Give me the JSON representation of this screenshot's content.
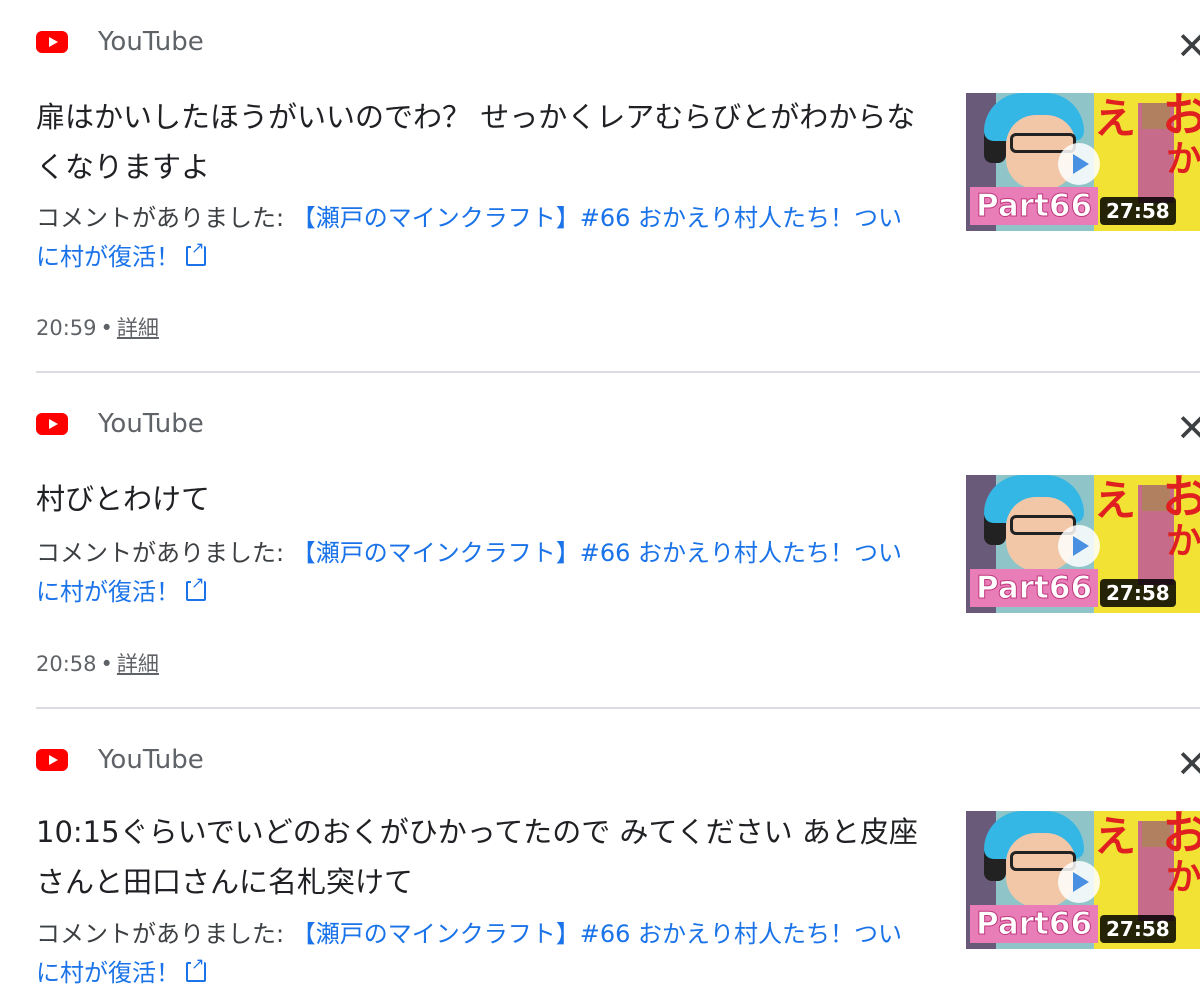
{
  "colors": {
    "youtube_red": "#ff0000",
    "link_blue": "#1a73e8",
    "divider": "#dadce0"
  },
  "notifications": [
    {
      "app_name": "YouTube",
      "app_icon": "youtube-logo-icon",
      "close_icon": "close-icon",
      "message": "扉はかいしたほうがいいのでわ？ せっかくレアむらびとがわからなくなりますよ",
      "comment_prefix": "コメントがありました: ",
      "video_title": "【瀬戸のマインクラフト】#66 おかえり村人たち！ついに村が復活！",
      "time": "20:59",
      "separator": "•",
      "details_label": "詳細",
      "thumbnail": {
        "label": "Part66",
        "duration": "27:58",
        "text_1": "え",
        "text_2": "お",
        "text_3": "か"
      }
    },
    {
      "app_name": "YouTube",
      "app_icon": "youtube-logo-icon",
      "close_icon": "close-icon",
      "message": "村びとわけて",
      "comment_prefix": "コメントがありました: ",
      "video_title": "【瀬戸のマインクラフト】#66 おかえり村人たち！ついに村が復活！",
      "time": "20:58",
      "separator": "•",
      "details_label": "詳細",
      "thumbnail": {
        "label": "Part66",
        "duration": "27:58",
        "text_1": "え",
        "text_2": "お",
        "text_3": "か"
      }
    },
    {
      "app_name": "YouTube",
      "app_icon": "youtube-logo-icon",
      "close_icon": "close-icon",
      "message": "10:15ぐらいでいどのおくがひかってたので みてください あと皮座さんと田口さんに名札突けて",
      "comment_prefix": "コメントがありました: ",
      "video_title": "【瀬戸のマインクラフト】#66 おかえり村人たち！ついに村が復活！",
      "thumbnail": {
        "label": "Part66",
        "duration": "27:58",
        "text_1": "え",
        "text_2": "お",
        "text_3": "か"
      }
    }
  ]
}
